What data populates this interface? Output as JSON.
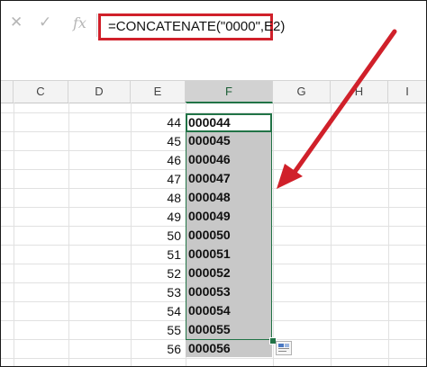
{
  "formula_bar": {
    "cancel_icon": "cancel-icon",
    "enter_icon": "check-icon",
    "function_icon": "fx-icon",
    "cancel_glyph": "✕",
    "enter_glyph": "✓",
    "fx_glyph": "fx",
    "formula": "=CONCATENATE(\"0000\",E2)"
  },
  "column_headers": [
    "C",
    "D",
    "E",
    "F",
    "G",
    "H",
    "I"
  ],
  "selected_column": "F",
  "rows": [
    {
      "e": "44",
      "f": "000044"
    },
    {
      "e": "45",
      "f": "000045"
    },
    {
      "e": "46",
      "f": "000046"
    },
    {
      "e": "47",
      "f": "000047"
    },
    {
      "e": "48",
      "f": "000048"
    },
    {
      "e": "49",
      "f": "000049"
    },
    {
      "e": "50",
      "f": "000050"
    },
    {
      "e": "51",
      "f": "000051"
    },
    {
      "e": "52",
      "f": "000052"
    },
    {
      "e": "53",
      "f": "000053"
    },
    {
      "e": "54",
      "f": "000054"
    },
    {
      "e": "55",
      "f": "000055"
    },
    {
      "e": "56",
      "f": "000056"
    }
  ],
  "colors": {
    "highlight_box": "#d0202a",
    "arrow": "#d0202a",
    "selection": "#217346",
    "selected_fill": "#c8c8c8"
  }
}
